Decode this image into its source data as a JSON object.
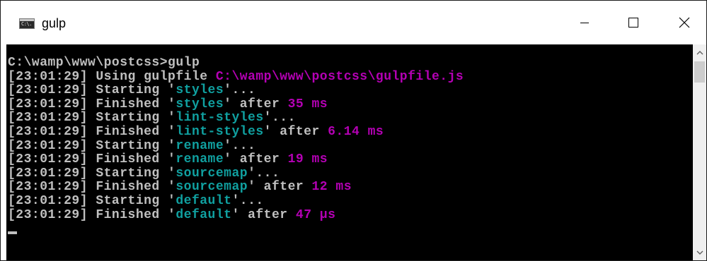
{
  "window": {
    "title": "gulp",
    "icon": "console-icon",
    "icon_glyph": "C:\\."
  },
  "colors": {
    "console_bg": "#000000",
    "text_default": "#c0c0c0",
    "text_magenta": "#b400b4",
    "text_teal": "#10a0a0"
  },
  "console": {
    "lines": [
      [
        {
          "text": "C:\\wamp\\www\\postcss>gulp",
          "color": "default"
        }
      ],
      [
        {
          "text": "[23:01:29] Using gulpfile ",
          "color": "default"
        },
        {
          "text": "C:\\wamp\\www\\postcss\\gulpfile.js",
          "color": "magenta"
        }
      ],
      [
        {
          "text": "[23:01:29] Starting '",
          "color": "default"
        },
        {
          "text": "styles",
          "color": "teal"
        },
        {
          "text": "'...",
          "color": "default"
        }
      ],
      [
        {
          "text": "[23:01:29] Finished '",
          "color": "default"
        },
        {
          "text": "styles",
          "color": "teal"
        },
        {
          "text": "' after ",
          "color": "default"
        },
        {
          "text": "35 ms",
          "color": "magenta"
        }
      ],
      [
        {
          "text": "[23:01:29] Starting '",
          "color": "default"
        },
        {
          "text": "lint-styles",
          "color": "teal"
        },
        {
          "text": "'...",
          "color": "default"
        }
      ],
      [
        {
          "text": "[23:01:29] Finished '",
          "color": "default"
        },
        {
          "text": "lint-styles",
          "color": "teal"
        },
        {
          "text": "' after ",
          "color": "default"
        },
        {
          "text": "6.14 ms",
          "color": "magenta"
        }
      ],
      [
        {
          "text": "[23:01:29] Starting '",
          "color": "default"
        },
        {
          "text": "rename",
          "color": "teal"
        },
        {
          "text": "'...",
          "color": "default"
        }
      ],
      [
        {
          "text": "[23:01:29] Finished '",
          "color": "default"
        },
        {
          "text": "rename",
          "color": "teal"
        },
        {
          "text": "' after ",
          "color": "default"
        },
        {
          "text": "19 ms",
          "color": "magenta"
        }
      ],
      [
        {
          "text": "[23:01:29] Starting '",
          "color": "default"
        },
        {
          "text": "sourcemap",
          "color": "teal"
        },
        {
          "text": "'...",
          "color": "default"
        }
      ],
      [
        {
          "text": "[23:01:29] Finished '",
          "color": "default"
        },
        {
          "text": "sourcemap",
          "color": "teal"
        },
        {
          "text": "' after ",
          "color": "default"
        },
        {
          "text": "12 ms",
          "color": "magenta"
        }
      ],
      [
        {
          "text": "[23:01:29] Starting '",
          "color": "default"
        },
        {
          "text": "default",
          "color": "teal"
        },
        {
          "text": "'...",
          "color": "default"
        }
      ],
      [
        {
          "text": "[23:01:29] Finished '",
          "color": "default"
        },
        {
          "text": "default",
          "color": "teal"
        },
        {
          "text": "' after ",
          "color": "default"
        },
        {
          "text": "47 μs",
          "color": "magenta"
        }
      ]
    ]
  },
  "controls": {
    "minimize": "minimize-icon",
    "maximize": "maximize-icon",
    "close": "close-icon"
  },
  "scrollbar": {
    "up": "chevron-up-icon",
    "down": "chevron-down-icon"
  }
}
